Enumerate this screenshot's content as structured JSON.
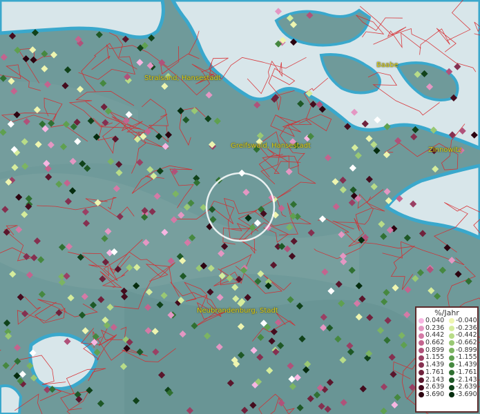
{
  "map": {
    "cities": [
      {
        "name": "Stralsund, Hansestadt"
      },
      {
        "name": "Baabe"
      },
      {
        "name": "Greifswald, Hansestadt"
      },
      {
        "name": "Zinnowitz"
      },
      {
        "name": "Neubrandenburg, Stadt"
      }
    ],
    "colors": {
      "sea": "#d8e6ea",
      "land": "#6f9a9a",
      "coast": "#3aa8cc",
      "border": "#d8282c",
      "label": "#d8cf18",
      "highlight_circle": "#ffffff"
    }
  },
  "legend": {
    "title": "%/Jahr",
    "positive": [
      {
        "value": "0.040",
        "color": "#f7b6e2"
      },
      {
        "value": "0.236",
        "color": "#e497c3"
      },
      {
        "value": "0.442",
        "color": "#d47aa6"
      },
      {
        "value": "0.662",
        "color": "#c3648e"
      },
      {
        "value": "0.899",
        "color": "#b0527a"
      },
      {
        "value": "1.155",
        "color": "#9a4064"
      },
      {
        "value": "1.439",
        "color": "#853050"
      },
      {
        "value": "1.761",
        "color": "#70223c"
      },
      {
        "value": "2.143",
        "color": "#5a162c"
      },
      {
        "value": "2.639",
        "color": "#440c1e"
      },
      {
        "value": "3.690",
        "color": "#2c0410"
      }
    ],
    "negative": [
      {
        "value": "-0.040",
        "color": "#eef5b0"
      },
      {
        "value": "-0.236",
        "color": "#d5ec9c"
      },
      {
        "value": "-0.442",
        "color": "#b8dc88"
      },
      {
        "value": "-0.662",
        "color": "#99c874"
      },
      {
        "value": "-0.899",
        "color": "#7cb462"
      },
      {
        "value": "-1.155",
        "color": "#5fa050"
      },
      {
        "value": "-1.439",
        "color": "#468840"
      },
      {
        "value": "-1.761",
        "color": "#307032"
      },
      {
        "value": "-2.143",
        "color": "#1e5826"
      },
      {
        "value": "-2.639",
        "color": "#10421a"
      },
      {
        "value": "-3.690",
        "color": "#052c0e"
      }
    ]
  }
}
